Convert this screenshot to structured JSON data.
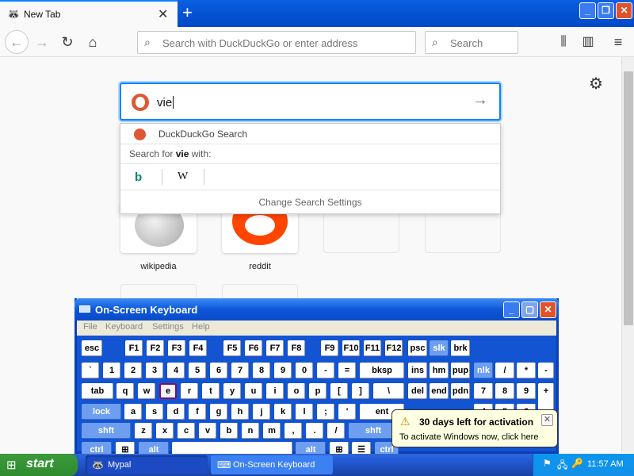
{
  "browser": {
    "tab_title": "New Tab",
    "tab_close": "✕",
    "new_tab": "+",
    "url_placeholder": "Search with DuckDuckGo or enter address",
    "search_placeholder": "Search",
    "window_buttons": {
      "minimize": "_",
      "maximize": "❐",
      "close": "✕"
    }
  },
  "newtab": {
    "search_text": "vie",
    "dropdown": {
      "engine_label": "DuckDuckGo Search",
      "search_for_prefix": "Search for ",
      "search_for_term": "vie",
      "search_for_suffix": " with:",
      "engines": [
        "b",
        "W"
      ],
      "settings_label": "Change Search Settings"
    },
    "tiles": [
      {
        "label": "wikipedia"
      },
      {
        "label": "reddit"
      }
    ]
  },
  "osk": {
    "title": "On-Screen Keyboard",
    "menu": [
      "File",
      "Keyboard",
      "Settings",
      "Help"
    ],
    "keys": {
      "esc": "esc",
      "f1": "F1",
      "f2": "F2",
      "f3": "F3",
      "f4": "F4",
      "f5": "F5",
      "f6": "F6",
      "f7": "F7",
      "f8": "F8",
      "f9": "F9",
      "f10": "F10",
      "f11": "F11",
      "f12": "F12",
      "psc": "psc",
      "slk": "slk",
      "brk": "brk",
      "backtick": "`",
      "k1": "1",
      "k2": "2",
      "k3": "3",
      "k4": "4",
      "k5": "5",
      "k6": "6",
      "k7": "7",
      "k8": "8",
      "k9": "9",
      "k0": "0",
      "minus": "-",
      "equals": "=",
      "bksp": "bksp",
      "ins": "ins",
      "hm": "hm",
      "pup": "pup",
      "nlk": "nlk",
      "slash": "/",
      "star": "*",
      "dash": "-",
      "tab": "tab",
      "q": "q",
      "w": "w",
      "e": "e",
      "r": "r",
      "t": "t",
      "y": "y",
      "u": "u",
      "i": "i",
      "o": "o",
      "p": "p",
      "lbr": "[",
      "rbr": "]",
      "bslash": "\\",
      "del": "del",
      "end": "end",
      "pdn": "pdn",
      "n7": "7",
      "n8": "8",
      "n9": "9",
      "plus": "+",
      "lock": "lock",
      "a": "a",
      "s": "s",
      "d": "d",
      "f": "f",
      "g": "g",
      "h": "h",
      "j": "j",
      "k": "k",
      "l": "l",
      "semi": ";",
      "quote": "'",
      "ent": "ent",
      "n4": "4",
      "n5": "5",
      "n6": "6",
      "shft": "shft",
      "z": "z",
      "x": "x",
      "c": "c",
      "v": "v",
      "b": "b",
      "n": "n",
      "m": "m",
      "comma": ",",
      "period": ".",
      "fslash": "/",
      "shft2": "shft",
      "ctrl": "ctrl",
      "alt": "alt",
      "alt2": "alt",
      "ctrl2": "ctrl"
    }
  },
  "balloon": {
    "heading": "30 days left for activation",
    "text": "To activate Windows now, click here",
    "close": "✕"
  },
  "taskbar": {
    "start_label": "start",
    "tasks": [
      "Mypal",
      "On-Screen Keyboard"
    ],
    "clock": "11:57 AM"
  }
}
